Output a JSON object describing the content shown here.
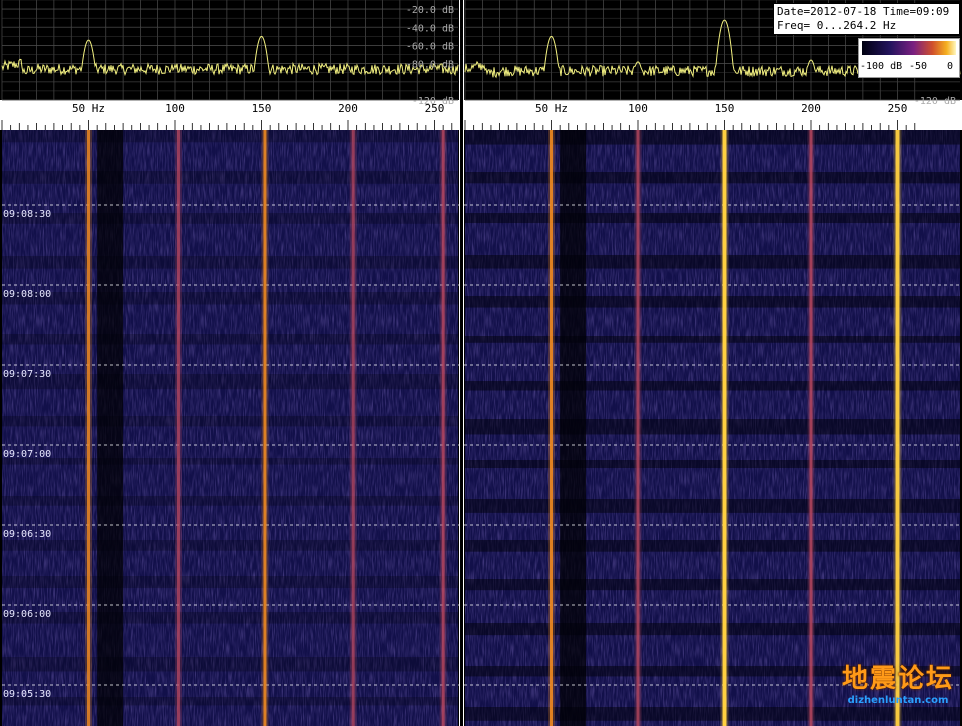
{
  "info": {
    "date_line": "Date=2012-07-18 Time=09:09",
    "freq_line": "Freq= 0...264.2 Hz"
  },
  "colorbar": {
    "labels": [
      "-100 dB",
      "-50",
      "0"
    ]
  },
  "watermark": {
    "cn": "地震论坛",
    "en": "dizhenluntan.com"
  },
  "chart_data": [
    {
      "type": "line",
      "panel": "left",
      "x_unit": "Hz",
      "xlim": [
        0,
        264.2
      ],
      "ylim": [
        -120,
        -10
      ],
      "x_ticks": [
        {
          "value": 50,
          "label": "50 Hz"
        },
        {
          "value": 100,
          "label": "100"
        },
        {
          "value": 150,
          "label": "150"
        },
        {
          "value": 200,
          "label": "200"
        },
        {
          "value": 250,
          "label": "250"
        }
      ],
      "y_ticks": [
        {
          "value": -20,
          "label": "-20.0 dB"
        },
        {
          "value": -40,
          "label": "-40.0 dB"
        },
        {
          "value": -60,
          "label": "-60.0 dB"
        },
        {
          "value": -80,
          "label": "-80.0 dB"
        },
        {
          "value": -120,
          "label": "-120 dB"
        }
      ],
      "grid": true,
      "line_color": "#f2f080",
      "baseline_db": -86,
      "peaks": [
        {
          "freq": 50,
          "db": -54
        },
        {
          "freq": 100,
          "db": -84
        },
        {
          "freq": 150,
          "db": -50
        },
        {
          "freq": 200,
          "db": -86
        },
        {
          "freq": 250,
          "db": -82
        }
      ]
    },
    {
      "type": "line",
      "panel": "right",
      "x_unit": "Hz",
      "xlim": [
        0,
        264.2
      ],
      "ylim": [
        -120,
        -10
      ],
      "x_ticks": [
        {
          "value": 50,
          "label": "50 Hz"
        },
        {
          "value": 100,
          "label": "100"
        },
        {
          "value": 150,
          "label": "150"
        },
        {
          "value": 200,
          "label": "200"
        },
        {
          "value": 250,
          "label": "250"
        }
      ],
      "y_ticks": [
        {
          "value": -120,
          "label": "-120 dB"
        }
      ],
      "grid": true,
      "line_color": "#f2f080",
      "baseline_db": -88,
      "peaks": [
        {
          "freq": 50,
          "db": -50
        },
        {
          "freq": 100,
          "db": -78
        },
        {
          "freq": 150,
          "db": -32
        },
        {
          "freq": 200,
          "db": -76
        },
        {
          "freq": 250,
          "db": -70
        }
      ]
    },
    {
      "type": "heatmap",
      "panel": "left",
      "x_unit": "Hz",
      "xlim": [
        0,
        264.2
      ],
      "time_range": [
        "09:05:15",
        "09:09:00"
      ],
      "time_labels": [
        "09:08:30",
        "09:08:00",
        "09:07:30",
        "09:07:00",
        "09:06:30",
        "09:06:00",
        "09:05:30"
      ],
      "lines": [
        {
          "freq": 50,
          "intensity": 0.62
        },
        {
          "freq": 102,
          "intensity": 0.35
        },
        {
          "freq": 152,
          "intensity": 0.75
        },
        {
          "freq": 203,
          "intensity": 0.3
        },
        {
          "freq": 255,
          "intensity": 0.5
        }
      ]
    },
    {
      "type": "heatmap",
      "panel": "right",
      "x_unit": "Hz",
      "xlim": [
        0,
        264.2
      ],
      "time_range": [
        "09:05:15",
        "09:09:00"
      ],
      "lines": [
        {
          "freq": 50,
          "intensity": 0.8
        },
        {
          "freq": 100,
          "intensity": 0.45
        },
        {
          "freq": 150,
          "intensity": 1.0
        },
        {
          "freq": 200,
          "intensity": 0.55
        },
        {
          "freq": 250,
          "intensity": 0.9
        }
      ]
    }
  ]
}
